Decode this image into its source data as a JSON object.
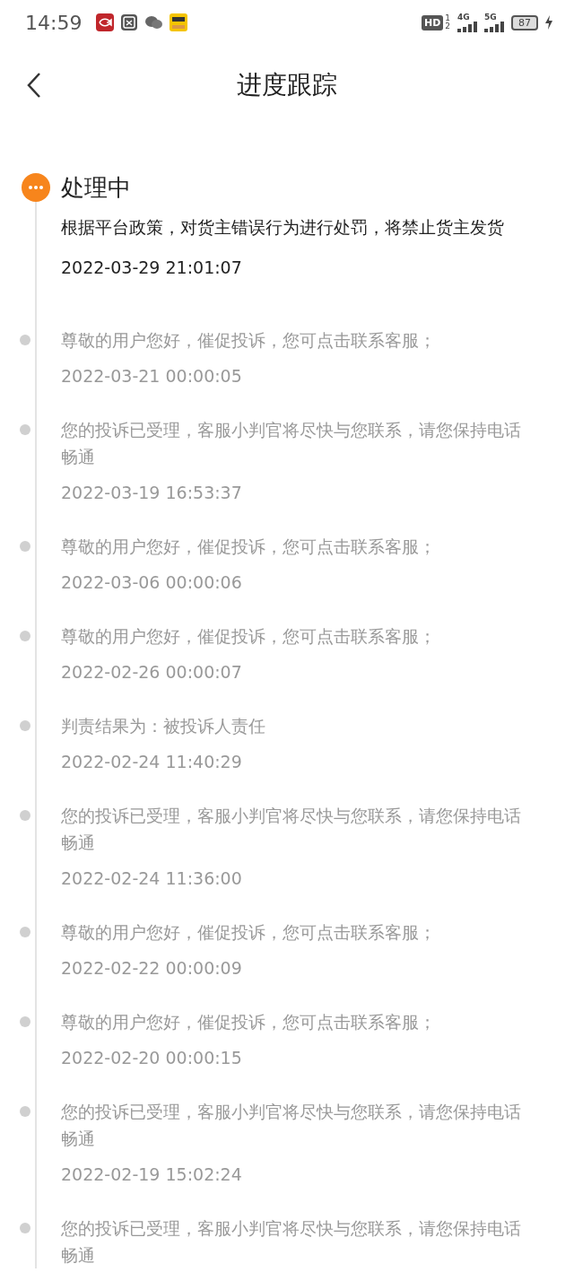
{
  "status_bar": {
    "time": "14:59",
    "hd": {
      "label": "HD",
      "sims": [
        "1",
        "2"
      ]
    },
    "networks": [
      {
        "label": "4G"
      },
      {
        "label": "5G"
      }
    ],
    "battery": "87"
  },
  "header": {
    "title": "进度跟踪"
  },
  "events": [
    {
      "current": true,
      "status": "处理中",
      "text": "根据平台政策，对货主错误行为进行处罚，将禁止货主发货",
      "time": "2022-03-29 21:01:07"
    },
    {
      "current": false,
      "text": "尊敬的用户您好，催促投诉，您可点击联系客服；",
      "time": "2022-03-21 00:00:05"
    },
    {
      "current": false,
      "text": "您的投诉已受理，客服小判官将尽快与您联系，请您保持电话畅通",
      "time": "2022-03-19 16:53:37"
    },
    {
      "current": false,
      "text": "尊敬的用户您好，催促投诉，您可点击联系客服；",
      "time": "2022-03-06 00:00:06"
    },
    {
      "current": false,
      "text": "尊敬的用户您好，催促投诉，您可点击联系客服；",
      "time": "2022-02-26 00:00:07"
    },
    {
      "current": false,
      "text": "判责结果为：被投诉人责任",
      "time": "2022-02-24 11:40:29"
    },
    {
      "current": false,
      "text": "您的投诉已受理，客服小判官将尽快与您联系，请您保持电话畅通",
      "time": "2022-02-24 11:36:00"
    },
    {
      "current": false,
      "text": "尊敬的用户您好，催促投诉，您可点击联系客服；",
      "time": "2022-02-22 00:00:09"
    },
    {
      "current": false,
      "text": "尊敬的用户您好，催促投诉，您可点击联系客服；",
      "time": "2022-02-20 00:00:15"
    },
    {
      "current": false,
      "text": "您的投诉已受理，客服小判官将尽快与您联系，请您保持电话畅通",
      "time": "2022-02-19 15:02:24"
    },
    {
      "current": false,
      "text": "您的投诉已受理，客服小判官将尽快与您联系，请您保持电话畅通"
    }
  ]
}
